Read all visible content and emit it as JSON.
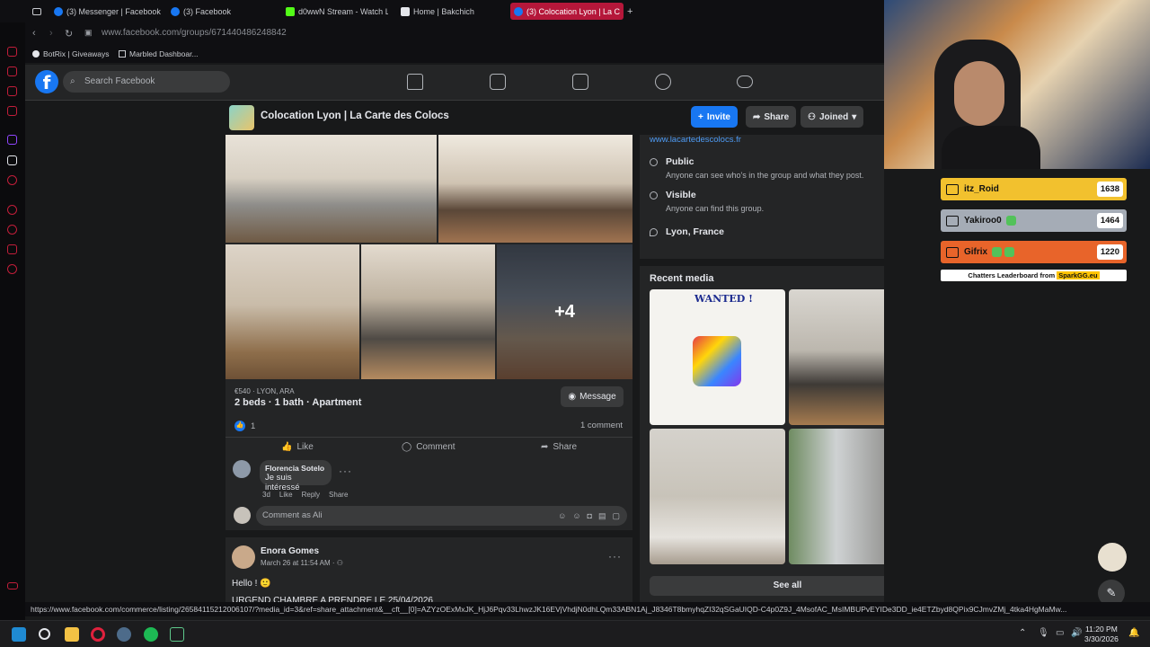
{
  "browser": {
    "tabs": [
      {
        "label": "(3) Messenger | Facebook"
      },
      {
        "label": "(3) Facebook"
      },
      {
        "label": "d0wwN Stream - Watch L"
      },
      {
        "label": "Home | Bakchich"
      },
      {
        "label": "(3) Colocation Lyon | La C"
      }
    ],
    "url": "www.facebook.com/groups/671440486248842",
    "bookmarks": [
      {
        "label": "BotRix | Giveaways"
      },
      {
        "label": "Marbled Dashboar..."
      }
    ],
    "status_url": "https://www.facebook.com/commerce/listing/26584115212006107/?media_id=3&ref=share_attachment&__cft__[0]=AZYzOExMxJK_HjJ6Pqv33LhwzJK16EVjVhdjN0dhLQm33ABN1Aj_J8346T8bmyhqZI32qSGaUIQD-C4p0Z9J_4MsofAC_MsIMBUPvEYIDe3DD_ie4ETZbyd8QPix9CJmvZMj_4tka4HgMaMw..."
  },
  "facebook": {
    "search_placeholder": "Search Facebook",
    "logo": "f"
  },
  "group": {
    "title": "Colocation Lyon | La Carte des Colocs",
    "invite_label": "Invite",
    "share_label": "Share",
    "joined_label": "Joined"
  },
  "post": {
    "more_photos": "+4",
    "price_location": "€540 · LYON, ARA",
    "title": "2 beds · 1 bath · Apartment",
    "message_label": "Message",
    "reaction_count": "1",
    "comment_count": "1 comment",
    "like_label": "Like",
    "comment_label": "Comment",
    "share_label": "Share",
    "comment": {
      "author": "Florencia Sotelo",
      "text": "Je suis intéressé",
      "age": "3d",
      "like": "Like",
      "reply": "Reply",
      "share": "Share"
    },
    "comment_placeholder": "Comment as Ali"
  },
  "post2": {
    "author": "Enora Gomes",
    "date": "March 26 at 11:54 AM ·",
    "line1": "Hello ! 🙂",
    "line2": "URGEND CHAMBRE A PRENDRE LE 25/04/2026"
  },
  "about": {
    "link": "www.lacartedescolocs.fr",
    "public_title": "Public",
    "public_sub": "Anyone can see who's in the group and what they post.",
    "visible_title": "Visible",
    "visible_sub": "Anyone can find this group.",
    "location": "Lyon, France"
  },
  "media": {
    "title": "Recent media",
    "poster_text": "WANTED !",
    "see_all": "See all"
  },
  "leaderboard": {
    "rows": [
      {
        "name": "itz_Roid",
        "score": "1638",
        "color": "#f2c12e"
      },
      {
        "name": "Yakiroo0",
        "score": "1464",
        "color": "#a5acb6"
      },
      {
        "name": "Gifrix",
        "score": "1220",
        "color": "#e8642a"
      }
    ],
    "footer_prefix": "Chatters Leaderboard from",
    "footer_brand": "SparkGG.eu"
  },
  "taskbar": {
    "time": "11:20 PM",
    "date": "3/30/2026"
  },
  "colors": {
    "accent": "#1877f2",
    "opera_red": "#c21e3a"
  }
}
